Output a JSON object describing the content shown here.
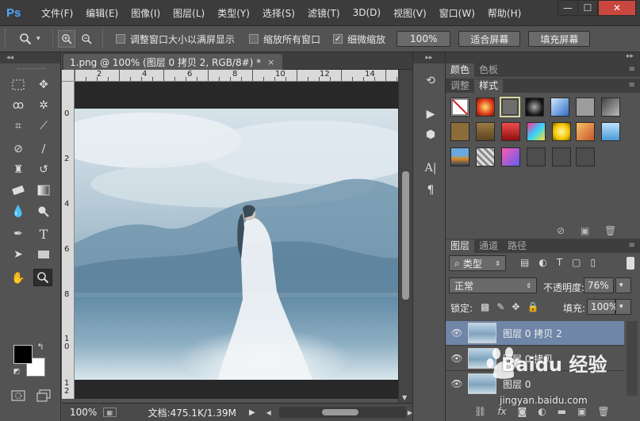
{
  "app": {
    "logo": "Ps"
  },
  "menu": [
    "文件(F)",
    "编辑(E)",
    "图像(I)",
    "图层(L)",
    "类型(Y)",
    "选择(S)",
    "滤镜(T)",
    "3D(D)",
    "视图(V)",
    "窗口(W)",
    "帮助(H)"
  ],
  "window_controls": {
    "minimize": "—",
    "maximize": "☐",
    "close": "✕"
  },
  "options": {
    "resize_windows_label": "调整窗口大小以满屏显示",
    "resize_windows_checked": false,
    "zoom_all_label": "缩放所有窗口",
    "zoom_all_checked": false,
    "scrubby_zoom_label": "细微缩放",
    "scrubby_zoom_checked": true,
    "actual_pixels_label": "100%",
    "fit_screen_label": "适合屏幕",
    "fill_screen_label": "填充屏幕"
  },
  "document": {
    "tab_title": "1.png @ 100% (图层 0 拷贝 2, RGB/8#) *",
    "tab_close": "×",
    "ruler_top_labels": [
      "2",
      "4",
      "6",
      "8",
      "10",
      "12",
      "14"
    ],
    "ruler_left_labels": [
      "0",
      "2",
      "4",
      "6",
      "8",
      "1 0",
      "1 2"
    ]
  },
  "status": {
    "zoom": "100%",
    "doc_size": "文档:475.1K/1.39M"
  },
  "panels": {
    "top_tabs": [
      "颜色",
      "色板"
    ],
    "style_tabs": [
      "调整",
      "样式"
    ],
    "active_style_tab": "样式",
    "layer_tabs": [
      "图层",
      "通道",
      "路径"
    ],
    "active_layer_tab": "图层"
  },
  "layers": {
    "filter_kind": "类型",
    "blend_mode": "正常",
    "opacity_label": "不透明度:",
    "opacity_value": "76%",
    "lock_label": "锁定:",
    "fill_label": "填充:",
    "fill_value": "100%",
    "items": [
      {
        "name": "图层 0 拷贝 2",
        "selected": true
      },
      {
        "name": "图层 0 拷贝",
        "selected": false
      },
      {
        "name": "图层 0",
        "selected": false
      }
    ]
  },
  "watermark": {
    "text": "Baidu 经验",
    "url": "jingyan.baidu.com"
  },
  "colors": {
    "accent": "#4fa8ff",
    "selection": "#6f86a8",
    "close_button": "#c9473f"
  }
}
